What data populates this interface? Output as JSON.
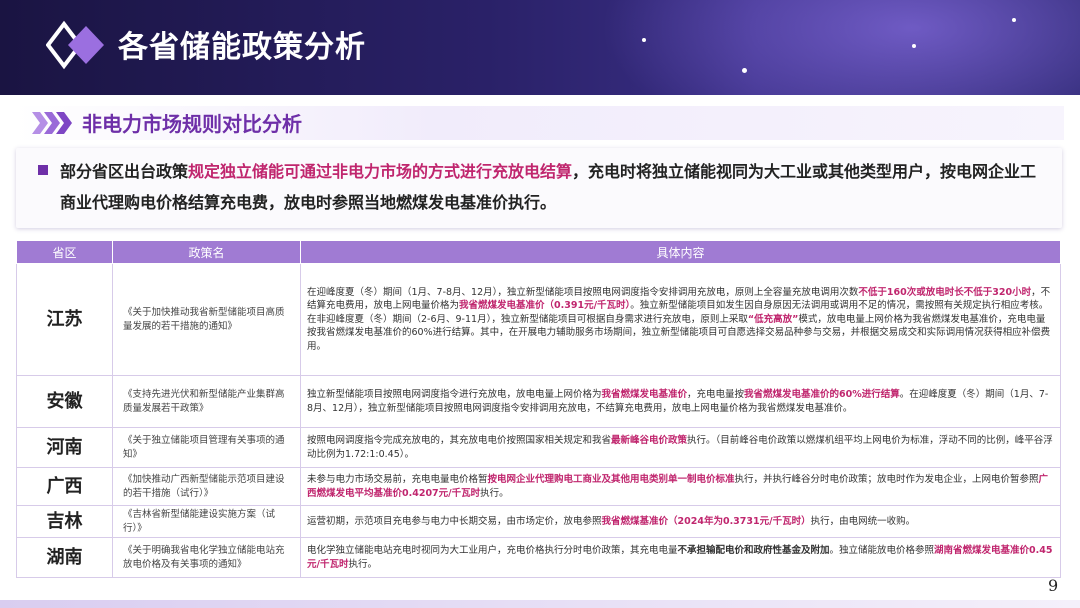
{
  "header": {
    "title": "各省储能政策分析"
  },
  "section": {
    "title": "非电力市场规则对比分析"
  },
  "summary": {
    "prefix": "部分省区出台政策",
    "highlight": "规定独立储能可通过非电力市场的方式进行充放电结算",
    "suffix": "，充电时将独立储能视同为大工业或其他类型用户，按电网企业工商业代理购电价格结算充电费，放电时参照当地燃煤发电基准价执行。"
  },
  "table": {
    "headers": {
      "province": "省区",
      "policy": "政策名",
      "content": "具体内容"
    },
    "rows": [
      {
        "province": "江苏",
        "policy": "《关于加快推动我省新型储能项目高质量发展的若干措施的通知》",
        "segments": [
          {
            "t": "在迎峰度夏（冬）期间（1月、7-8月、12月），独立新型储能项目按照电网调度指令安排调用充放电，原则上全容量充放电调用次数",
            "s": ""
          },
          {
            "t": "不低于160次或放电时长不低于320小时",
            "s": "red"
          },
          {
            "t": "，不结算充电费用，放电上网电量价格为",
            "s": ""
          },
          {
            "t": "我省燃煤发电基准价（0.391元/千瓦时）",
            "s": "red"
          },
          {
            "t": "。独立新型储能项目如发生因自身原因无法调用或调用不足的情况，需按照有关规定执行相应考核。",
            "s": ""
          },
          {
            "t": "在非迎峰度夏（冬）期间（2-6月、9-11月），独立新型储能项目可根据自身需求进行充放电，原则上采取",
            "s": "br"
          },
          {
            "t": "“低充高放”",
            "s": "red"
          },
          {
            "t": "模式，放电电量上网价格为我省燃煤发电基准价，充电电量按我省燃煤发电基准价的60%进行结算。其中，在开展电力辅助服务市场期间，独立新型储能项目可自愿选择交易品种参与交易，并根据交易成交和实际调用情况获得相应补偿费用。",
            "s": ""
          }
        ]
      },
      {
        "province": "安徽",
        "policy": "《支持先进光伏和新型储能产业集群高质量发展若干政策》",
        "segments": [
          {
            "t": "独立新型储能项目按照电网调度指令进行充放电，放电电量上网价格为",
            "s": ""
          },
          {
            "t": "我省燃煤发电基准价",
            "s": "red"
          },
          {
            "t": "，充电电量按",
            "s": ""
          },
          {
            "t": "我省燃煤发电基准价的60%进行结算",
            "s": "red"
          },
          {
            "t": "。在迎峰度夏（冬）期间（1月、7-8月、12月），独立新型储能项目按照电网调度指令安排调用充放电，不结算充电费用，放电上网电量价格为我省燃煤发电基准价。",
            "s": ""
          }
        ]
      },
      {
        "province": "河南",
        "policy": "《关于独立储能项目管理有关事项的通知》",
        "segments": [
          {
            "t": "按照电网调度指令完成充放电的，其充放电电价按照国家相关规定和我省",
            "s": ""
          },
          {
            "t": "最新峰谷电价政策",
            "s": "red"
          },
          {
            "t": "执行。（目前峰谷电价政策以燃煤机组平均上网电价为标准，浮动不同的比例，峰平谷浮动比例为1.72:1:0.45）。",
            "s": ""
          }
        ]
      },
      {
        "province": "广西",
        "policy": "《加快推动广西新型储能示范项目建设的若干措施（试行）》",
        "segments": [
          {
            "t": "未参与电力市场交易前，充电电量电价格暂",
            "s": ""
          },
          {
            "t": "按电网企业代理购电工商业及其他用电类别单一制电价标准",
            "s": "red"
          },
          {
            "t": "执行，并执行峰谷分时电价政策；放电时作为发电企业，上网电价暂参照",
            "s": ""
          },
          {
            "t": "广西燃煤发电平均基准价0.4207元/千瓦时",
            "s": "red"
          },
          {
            "t": "执行。",
            "s": ""
          }
        ]
      },
      {
        "province": "吉林",
        "policy": "《吉林省新型储能建设实施方案（试行）》",
        "segments": [
          {
            "t": "运营初期，示范项目充电参与电力中长期交易，由市场定价，放电参照",
            "s": ""
          },
          {
            "t": "我省燃煤基准价（2024年为0.3731元/千瓦时）",
            "s": "red"
          },
          {
            "t": "执行，由电网统一收购。",
            "s": ""
          }
        ]
      },
      {
        "province": "湖南",
        "policy": "《关于明确我省电化学独立储能电站充放电价格及有关事项的通知》",
        "segments": [
          {
            "t": "电化学独立储能电站充电时视同为大工业用户，充电价格执行分时电价政策，其充电电量",
            "s": ""
          },
          {
            "t": "不承担输配电价和政府性基金及附加",
            "s": "hlk"
          },
          {
            "t": "。独立储能放电价格参照",
            "s": ""
          },
          {
            "t": "湖南省燃煤发电基准价0.45元/千瓦时",
            "s": "red"
          },
          {
            "t": "执行。",
            "s": ""
          }
        ]
      }
    ]
  },
  "footer": {
    "page_number": "9"
  },
  "colors": {
    "accent": "#6e2fa8",
    "highlight": "#c0266e",
    "table_header": "#a07bd3",
    "banner": "#2a2168"
  },
  "icons": {
    "logo": "diamond-logo-icon",
    "section": "triple-chevron-icon",
    "bullet": "square-bullet-icon"
  }
}
